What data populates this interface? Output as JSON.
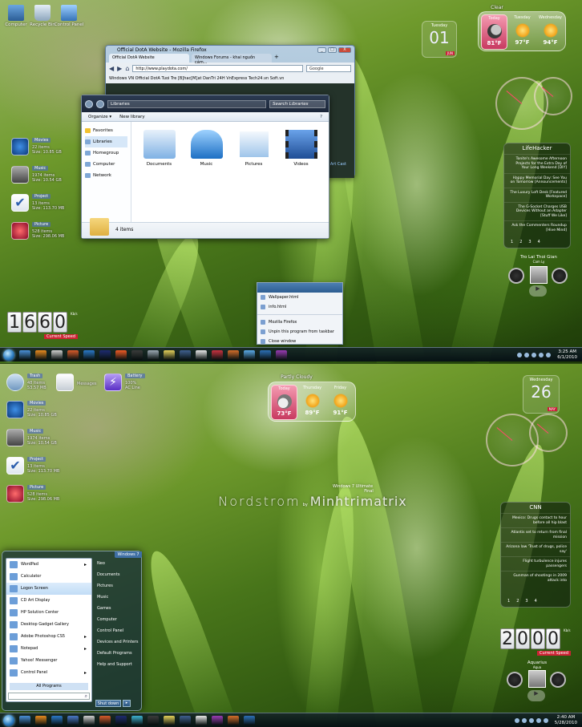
{
  "top": {
    "desktop_icons": [
      {
        "label": "Computer",
        "color": "#3b77b6"
      },
      {
        "label": "Recycle Bin",
        "color": "#9fb4c7"
      },
      {
        "label": "Control Panel",
        "color": "#4f8fd0"
      }
    ],
    "firefox": {
      "title": "Official DotA Website - Mozilla Firefox",
      "tabs": [
        "Official DotA Website",
        "Windows Forums - khai nguồn cảm..."
      ],
      "url": "http://www.playdota.com/",
      "search_placeholder": "Google",
      "bookmarks": "Windows VN   Official DotA   Tuoi Tre   [B]hac[M]at   DanTri   24H   VnExpress   Tech24.vn   Soft.vn",
      "window_buttons": [
        "_",
        "□",
        "X"
      ]
    },
    "explorer": {
      "breadcrumb": "Libraries",
      "search_placeholder": "Search Libraries",
      "toolbar": [
        "Organize ▾",
        "New library"
      ],
      "nav": [
        "Favorites",
        "Libraries",
        "Homegroup",
        "Computer",
        "Network"
      ],
      "libraries": [
        {
          "label": "Documents",
          "color": "#7fb1e4"
        },
        {
          "label": "Music",
          "color": "#2f8fe0"
        },
        {
          "label": "Pictures",
          "color": "#9fc5ea"
        },
        {
          "label": "Videos",
          "color": "#3c73c4"
        }
      ],
      "status": "4 items",
      "status_extra": "Art   Cast"
    },
    "context_menu": {
      "items": [
        "Wallpaper.html",
        "info.html"
      ],
      "actions": [
        "Mozilla Firefox",
        "Unpin this program from taskbar",
        "Close window"
      ]
    },
    "dock": [
      {
        "name": "Movies",
        "line1": "22 items",
        "line2": "Size: 10.85 GB",
        "color": "#1b5db5"
      },
      {
        "name": "Music",
        "line1": "1974 items",
        "line2": "Size: 10.54 GB",
        "color": "#7c7c7c"
      },
      {
        "name": "Project",
        "line1": "13 items",
        "line2": "Size: 113.70 MB",
        "color": "#2d5fae"
      },
      {
        "name": "Picture",
        "line1": "528 items",
        "line2": "Size: 298.06 MB",
        "color": "#c2183a"
      }
    ],
    "flip_counter": {
      "digits": [
        "1",
        "6",
        "6",
        "0"
      ],
      "label": "Current Speed",
      "unit": "Kb/s"
    },
    "calendar": {
      "day": "Tuesday",
      "date": "01",
      "month": "JUN"
    },
    "weather": {
      "condition": "Clear",
      "days": [
        {
          "name": "Today",
          "temp": "81°F"
        },
        {
          "name": "Tuesday",
          "temp": "97°F"
        },
        {
          "name": "Wednesday",
          "temp": "94°F"
        }
      ]
    },
    "feed": {
      "title": "LifeHacker",
      "items": [
        "Tonite's Awesome Afternoon Projects for the Extra Day of Your Long Weekend [DIY]",
        "Happy Memorial Day: See You on Tomorrow [Announcements]",
        "The Luxury Loft Desk [Featured Workspace]",
        "The G-Socket Charges USB Devices Without an Adapter [Stuff We Like]",
        "Ask the Commenters Roundup [Hive Mind]"
      ],
      "pages": [
        "1",
        "2",
        "3",
        "4"
      ]
    },
    "media": {
      "title": "Tro Lai Thoi Gian",
      "artist": "Cam Ly"
    },
    "taskbar": {
      "time": "3:25 AM",
      "date": "6/1/2010"
    },
    "taskbar_icons": [
      "#4a8fd8",
      "#e88a1e",
      "#cfcfcf",
      "#d85a2a",
      "#2a78c8",
      "#1d2a70",
      "#f05a24",
      "#3a3a3a",
      "#9ba8b4",
      "#e4d05a",
      "#3f5f8f",
      "#e8e8e8",
      "#c8313f",
      "#d46d2a",
      "#5aaae8",
      "#2c6fb6",
      "#9a3bb4"
    ]
  },
  "bottom": {
    "desktop_icons": [
      {
        "name": "Trash",
        "line1": "48 Items",
        "line2": "53.57 MB",
        "color": "#8aaed0"
      },
      {
        "name": "",
        "line1": "Messages",
        "line2": "",
        "color": "#d8dde2"
      },
      {
        "name": "Battery",
        "line1": "100%",
        "line2": "AC Line",
        "color": "#7a4fd0"
      }
    ],
    "dock": [
      {
        "name": "Movies",
        "line1": "22 items",
        "line2": "Size: 10.85 GB",
        "color": "#1b5db5"
      },
      {
        "name": "Music",
        "line1": "1974 items",
        "line2": "Size: 10.54 GB",
        "color": "#7c7c7c"
      },
      {
        "name": "Project",
        "line1": "13 items",
        "line2": "Size: 113.70 MB",
        "color": "#2d5fae"
      },
      {
        "name": "Picture",
        "line1": "528 items",
        "line2": "Size: 298.06 MB",
        "color": "#c2183a"
      }
    ],
    "weather": {
      "condition": "Partly Cloudy",
      "days": [
        {
          "name": "Today",
          "temp": "73°F"
        },
        {
          "name": "Thursday",
          "temp": "89°F"
        },
        {
          "name": "Friday",
          "temp": "91°F"
        }
      ]
    },
    "calendar": {
      "day": "Wednesday",
      "date": "26",
      "month": "MAY"
    },
    "branding": {
      "os": "Windows 7 Ultimate",
      "name": "Nordstrom",
      "final": "Final",
      "by": "by",
      "author": "Minhtrimatrix"
    },
    "feed": {
      "title": "CNN",
      "items": [
        "Mexico: Drugs contact to hour before all hip blast",
        "Atlantis set to return from final mission",
        "Arizona law 'Trust of drugs, police say'",
        "Flight turbulence injures passengers",
        "Gunman of shootings in 2009 attack into"
      ],
      "pages": [
        "1",
        "2",
        "3",
        "4"
      ]
    },
    "flip_counter": {
      "digits": [
        "2",
        "0",
        "0",
        "0"
      ],
      "label": "Current Speed",
      "unit": "Kb/s"
    },
    "media": {
      "title": "Aquarius",
      "artist": "Aqua"
    },
    "start_menu": {
      "programs": [
        {
          "label": "WordPad",
          "arrow": true
        },
        {
          "label": "Calculator",
          "arrow": false
        },
        {
          "label": "Logon Screen",
          "arrow": false,
          "selected": true
        },
        {
          "label": "CD Art Display",
          "arrow": false
        },
        {
          "label": "HP Solution Center",
          "arrow": false
        },
        {
          "label": "Desktop Gadget Gallery",
          "arrow": false
        },
        {
          "label": "Adobe Photoshop CS5",
          "arrow": true
        },
        {
          "label": "Notepad",
          "arrow": true
        },
        {
          "label": "Yahoo! Messenger",
          "arrow": false
        },
        {
          "label": "Control Panel",
          "arrow": true
        }
      ],
      "all_programs": "All Programs",
      "right": [
        "Neo",
        "Documents",
        "Pictures",
        "Music",
        "Games",
        "Computer",
        "Control Panel",
        "Devices and Printers",
        "Default Programs",
        "Help and Support"
      ],
      "shutdown": "Shut down",
      "logo": "Windows 7"
    },
    "taskbar": {
      "time": "2:40 AM",
      "date": "5/28/2010"
    },
    "taskbar_icons": [
      "#4a8fd8",
      "#e88a1e",
      "#2a78c8",
      "#4a78c8",
      "#cfcfcf",
      "#d85a2a",
      "#1d2a70",
      "#3cb0d0",
      "#3a3a3a",
      "#e4d05a",
      "#3f5f8f",
      "#e8e8e8",
      "#9a3bb4",
      "#d46d2a",
      "#2c6fb6"
    ]
  }
}
